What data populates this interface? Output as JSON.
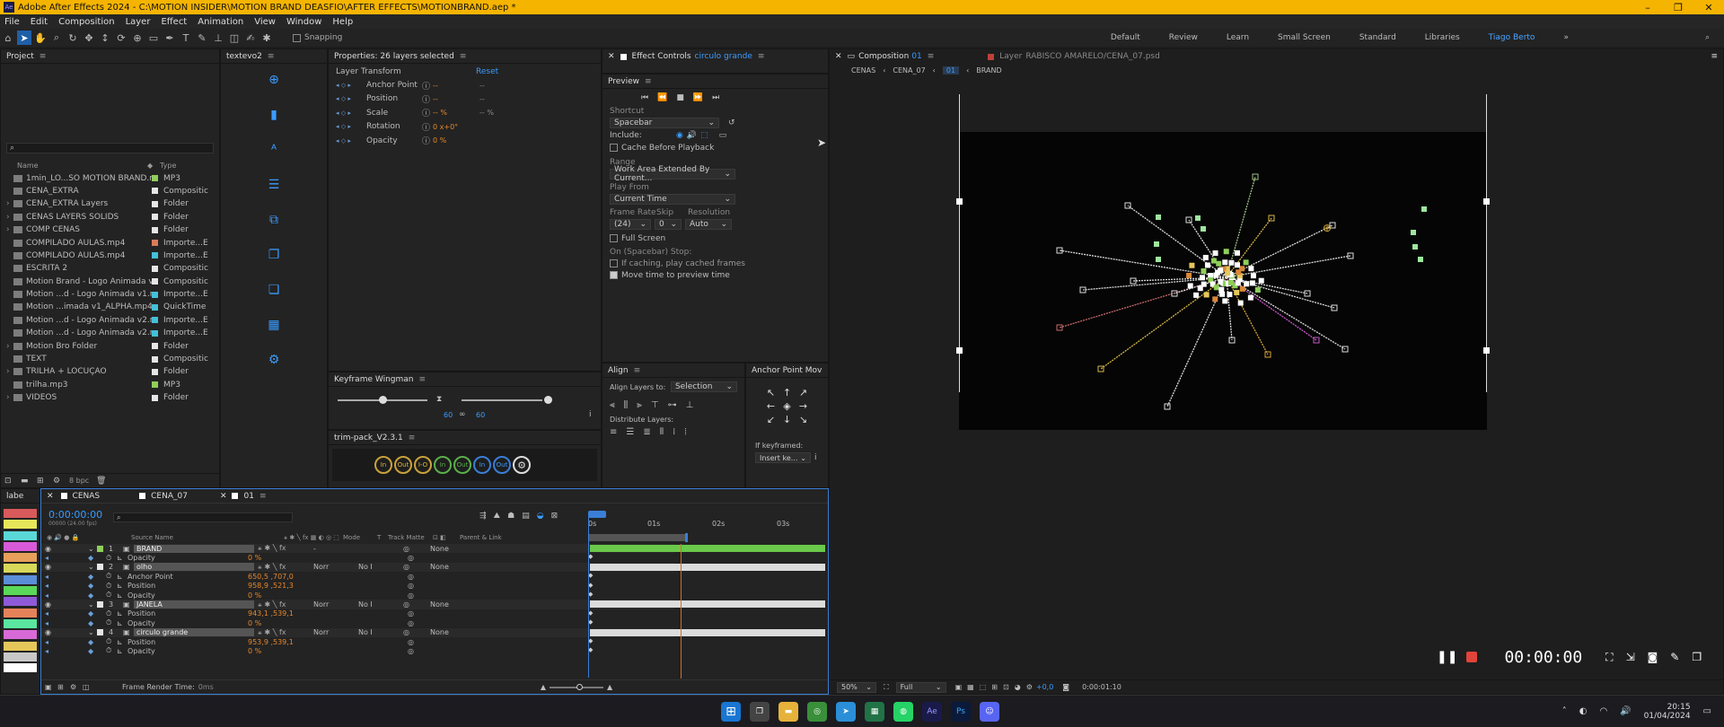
{
  "app": {
    "title": "Adobe After Effects 2024 - C:\\MOTION INSIDER\\MOTION BRAND DEASFIO\\AFTER EFFECTS\\MOTIONBRAND.aep *",
    "logo": "Ae"
  },
  "menu": [
    "File",
    "Edit",
    "Composition",
    "Layer",
    "Effect",
    "Animation",
    "View",
    "Window",
    "Help"
  ],
  "toolbar": {
    "snapping": "Snapping",
    "workspaces": [
      "Default",
      "Review",
      "Learn",
      "Small Screen",
      "Standard",
      "Libraries",
      "Tiago Berto"
    ],
    "more": "»"
  },
  "project": {
    "title": "Project",
    "col_name": "Name",
    "col_type": "Type",
    "footer_bpc": "8 bpc",
    "items": [
      {
        "name": "1min_LO...SO MOTION BRAND.mp3",
        "type": "MP3",
        "color": "#8fcf5a"
      },
      {
        "name": "CENA_EXTRA",
        "type": "Compositic",
        "color": "#e6e6e6"
      },
      {
        "name": "CENA_EXTRA Layers",
        "type": "Folder",
        "color": "#e6e6e6"
      },
      {
        "name": "CENAS LAYERS SOLIDS",
        "type": "Folder",
        "color": "#e6e6e6"
      },
      {
        "name": "COMP CENAS",
        "type": "Folder",
        "color": "#e6e6e6"
      },
      {
        "name": "COMPILADO AULAS.mp4",
        "type": "Importe...E",
        "color": "#d87b5a"
      },
      {
        "name": "COMPILADO AULAS.mp4",
        "type": "Importe...E",
        "color": "#44c0d8"
      },
      {
        "name": "ESCRITA 2",
        "type": "Compositic",
        "color": "#e6e6e6"
      },
      {
        "name": "Motion Brand - Logo Animada v1",
        "type": "Compositic",
        "color": "#e6e6e6"
      },
      {
        "name": "Motion ...d - Logo Animada v1.mp4",
        "type": "Importe...E",
        "color": "#44c0d8"
      },
      {
        "name": "Motion ...imada v1_ALPHA.mp4.mov",
        "type": "QuickTime",
        "color": "#44c0d8"
      },
      {
        "name": "Motion ...d - Logo Animada v2.mp4",
        "type": "Importe...E",
        "color": "#44c0d8"
      },
      {
        "name": "Motion ...d - Logo Animada v2.mp4",
        "type": "Importe...E",
        "color": "#44c0d8"
      },
      {
        "name": "Motion Bro Folder",
        "type": "Folder",
        "color": "#e6e6e6"
      },
      {
        "name": "TEXT",
        "type": "Compositic",
        "color": "#e6e6e6"
      },
      {
        "name": "TRILHA + LOCUÇÃO",
        "type": "Folder",
        "color": "#e6e6e6"
      },
      {
        "name": "trilha.mp3",
        "type": "MP3",
        "color": "#8fcf5a"
      },
      {
        "name": "VÍDEOS",
        "type": "Folder",
        "color": "#e6e6e6"
      }
    ]
  },
  "textevo": {
    "title": "textevo2"
  },
  "properties": {
    "title": "Properties: 26 layers selected",
    "section": "Layer Transform",
    "reset": "Reset",
    "rows": [
      {
        "label": "Anchor Point",
        "v1": "--",
        "v2": "--"
      },
      {
        "label": "Position",
        "v1": "--",
        "v2": "--"
      },
      {
        "label": "Scale",
        "v1": "-- %",
        "v2": "-- %"
      },
      {
        "label": "Rotation",
        "v1": "0 x+0°",
        "v2": ""
      },
      {
        "label": "Opacity",
        "v1": "0 %",
        "v2": ""
      }
    ]
  },
  "keyframe_wingman": {
    "title": "Keyframe Wingman",
    "v1": "60",
    "v2": "60"
  },
  "trimpack": {
    "title": "trim-pack_V2.3.1",
    "buttons": [
      "In",
      "Out",
      "I-O",
      "In",
      "Out",
      "In",
      "Out"
    ]
  },
  "effect_controls": {
    "title": "Effect Controls",
    "layer": "circulo grande"
  },
  "preview": {
    "title": "Preview",
    "shortcut_label": "Shortcut",
    "shortcut": "Spacebar",
    "include": "Include:",
    "cache": "Cache Before Playback",
    "range_label": "Range",
    "range": "Work Area Extended By Current...",
    "playfrom_label": "Play From",
    "playfrom": "Current Time",
    "framerate_label": "Frame Rate",
    "skip_label": "Skip",
    "resolution_label": "Resolution",
    "framerate": "(24)",
    "skip": "0",
    "resolution": "Auto",
    "fullscreen": "Full Screen",
    "onstop": "On (Spacebar) Stop:",
    "ifcaching": "If caching, play cached frames",
    "movetime": "Move time to preview time"
  },
  "align": {
    "title": "Align",
    "align_to_label": "Align Layers to:",
    "align_to": "Selection",
    "distribute": "Distribute Layers:"
  },
  "anchor": {
    "title": "Anchor Point Mov",
    "ifkey": "If keyframed:",
    "insert": "Insert ke..."
  },
  "composition": {
    "tab": "Composition",
    "tab_num": "01",
    "layer_tab": "Layer",
    "layer_name": "RABISCO AMARELO/CENA_07.psd",
    "breadcrumbs": [
      "CENAS",
      "CENA_07",
      "01",
      "BRAND"
    ],
    "zoom": "50%",
    "quality": "Full",
    "exposure": "+0,0",
    "timecode_small": "0:00:01:10",
    "big_timecode": "00:00:00"
  },
  "timeline": {
    "label_col": "labe",
    "tabs": [
      "CENAS",
      "CENA_07",
      "01"
    ],
    "timecode": "0:00:00:00",
    "fps": "00000 (24.00 fps)",
    "col_source": "Source Name",
    "col_mode": "Mode",
    "col_t": "T",
    "col_trackmatte": "Track Matte",
    "col_parent": "Parent & Link",
    "ruler": [
      "0s",
      "01s",
      "02s",
      "03s"
    ],
    "rows": [
      {
        "num": "1",
        "name": "BRAND",
        "kind": "layer",
        "mode": "-",
        "tm": "",
        "parent": "None",
        "color": "#8fcf5a"
      },
      {
        "num": "",
        "name": "Opacity",
        "kind": "prop",
        "value": "0 %"
      },
      {
        "num": "2",
        "name": "olho",
        "kind": "layer",
        "mode": "Norr",
        "tm": "No I",
        "parent": "None",
        "color": "#e6e6e6"
      },
      {
        "num": "",
        "name": "Anchor Point",
        "kind": "prop",
        "value": "650,5 ,707,0"
      },
      {
        "num": "",
        "name": "Position",
        "kind": "prop",
        "value": "958,9 ,521,3"
      },
      {
        "num": "",
        "name": "Opacity",
        "kind": "prop",
        "value": "0 %"
      },
      {
        "num": "3",
        "name": "JANELA",
        "kind": "layer",
        "mode": "Norr",
        "tm": "No I",
        "parent": "None",
        "color": "#e6e6e6"
      },
      {
        "num": "",
        "name": "Position",
        "kind": "prop",
        "value": "943,1 ,539,1"
      },
      {
        "num": "",
        "name": "Opacity",
        "kind": "prop",
        "value": "0 %"
      },
      {
        "num": "4",
        "name": "circulo grande",
        "kind": "layer",
        "mode": "Norr",
        "tm": "No I",
        "parent": "None",
        "color": "#e6e6e6"
      },
      {
        "num": "",
        "name": "Position",
        "kind": "prop",
        "value": "953,9 ,539,1"
      },
      {
        "num": "",
        "name": "Opacity",
        "kind": "prop",
        "value": "0 %"
      }
    ],
    "frame_render": "Frame Render Time:",
    "frame_render_val": "0ms"
  },
  "taskbar": {
    "time": "20:15",
    "date": "01/04/2024",
    "apps": [
      "Ae",
      "Ps"
    ]
  },
  "colors": {
    "accent": "#3a9cff",
    "title_bg": "#f5b400",
    "keyframe": "#e4882c"
  }
}
